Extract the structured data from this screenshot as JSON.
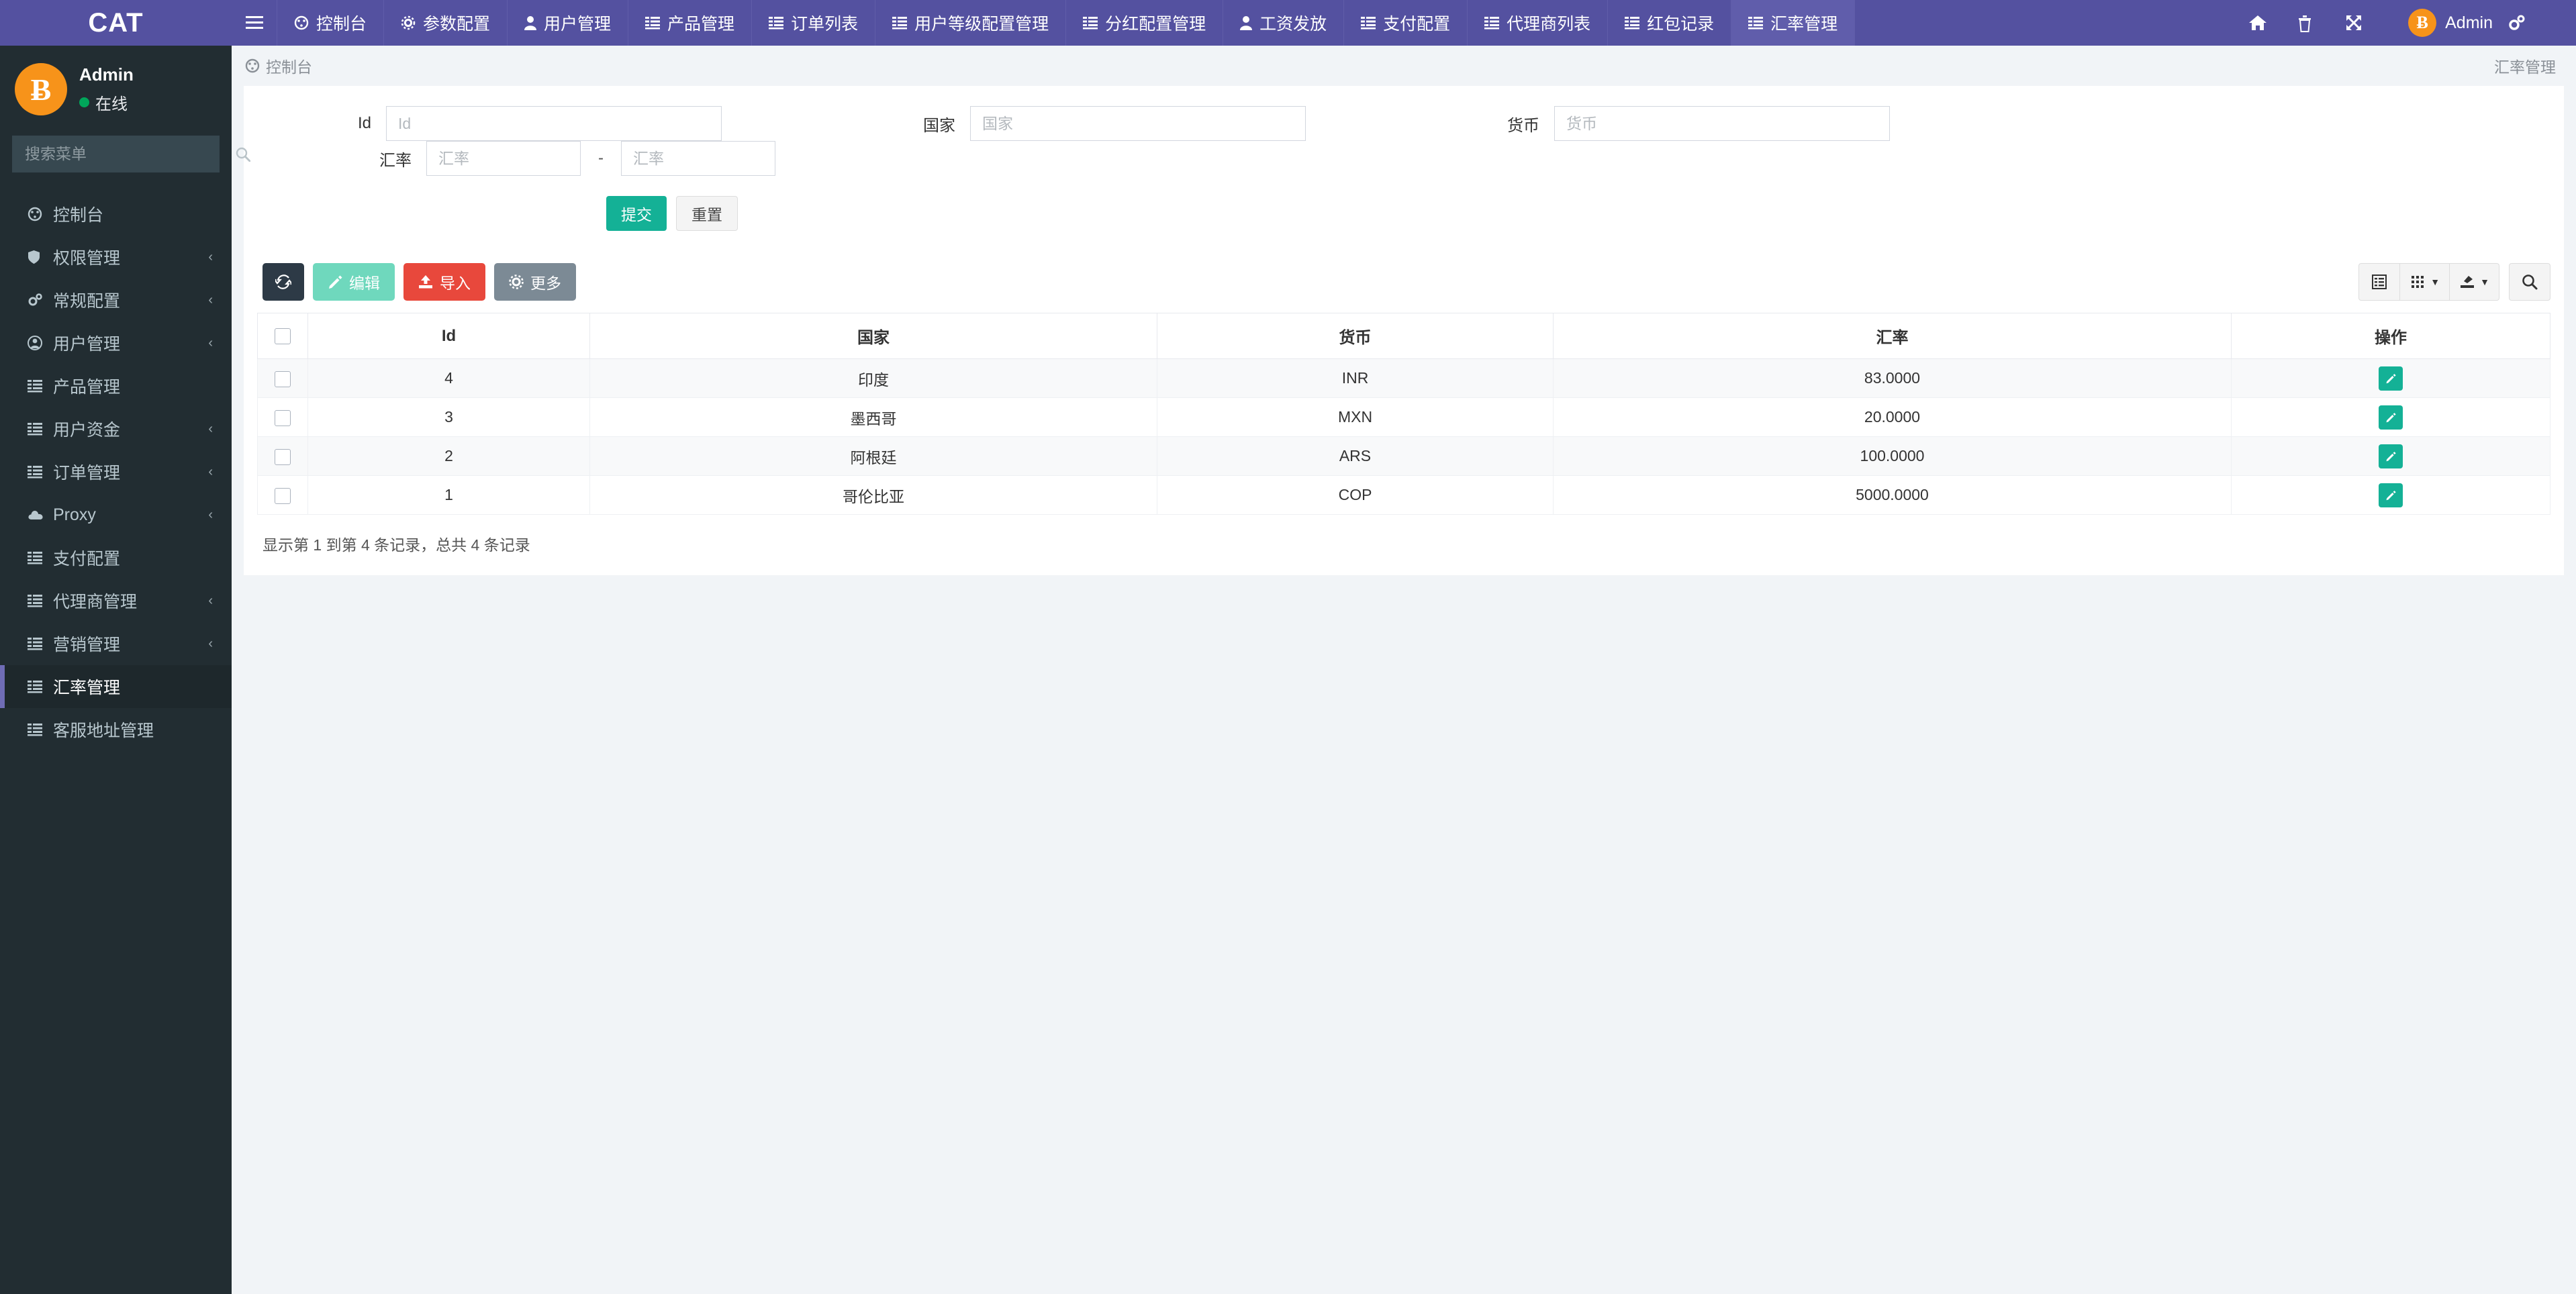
{
  "brand": {
    "title": "CAT"
  },
  "topnav": {
    "menu_icon": "hamburger-icon",
    "tabs": [
      {
        "label": "控制台",
        "icon": "dashboard-icon",
        "active": false
      },
      {
        "label": "参数配置",
        "icon": "gear-icon",
        "active": false
      },
      {
        "label": "用户管理",
        "icon": "user-icon",
        "active": false
      },
      {
        "label": "产品管理",
        "icon": "list-icon",
        "active": false
      },
      {
        "label": "订单列表",
        "icon": "list-icon",
        "active": false
      },
      {
        "label": "用户等级配置管理",
        "icon": "list-icon",
        "active": false
      },
      {
        "label": "分红配置管理",
        "icon": "list-icon",
        "active": false
      },
      {
        "label": "工资发放",
        "icon": "user-icon",
        "active": false
      },
      {
        "label": "支付配置",
        "icon": "list-icon",
        "active": false
      },
      {
        "label": "代理商列表",
        "icon": "list-icon",
        "active": false
      },
      {
        "label": "红包记录",
        "icon": "list-icon",
        "active": false
      },
      {
        "label": "汇率管理",
        "icon": "list-icon",
        "active": true
      }
    ],
    "right_icons": [
      {
        "name": "home-icon",
        "glyph": "⌂"
      },
      {
        "name": "trash-icon",
        "glyph": "🗑"
      },
      {
        "name": "fullscreen-icon",
        "glyph": "⤢"
      }
    ],
    "user": {
      "name": "Admin",
      "avatar": "bitcoin-icon",
      "avatar_glyph": "Ƀ"
    },
    "settings_icon": "gears-icon"
  },
  "sidebar": {
    "user": {
      "name": "Admin",
      "status": "在线",
      "avatar_glyph": "Ƀ"
    },
    "search": {
      "placeholder": "搜索菜单",
      "value": "",
      "icon": "search-icon"
    },
    "items": [
      {
        "label": "控制台",
        "icon": "dashboard-icon",
        "arrow": "",
        "active": false
      },
      {
        "label": "权限管理",
        "icon": "shield-icon",
        "arrow": "‹",
        "active": false
      },
      {
        "label": "常规配置",
        "icon": "gears-icon",
        "arrow": "‹",
        "active": false
      },
      {
        "label": "用户管理",
        "icon": "user-circle-icon",
        "arrow": "‹",
        "active": false
      },
      {
        "label": "产品管理",
        "icon": "list-icon",
        "arrow": "",
        "active": false
      },
      {
        "label": "用户资金",
        "icon": "list-icon",
        "arrow": "‹",
        "active": false
      },
      {
        "label": "订单管理",
        "icon": "list-icon",
        "arrow": "‹",
        "active": false
      },
      {
        "label": "Proxy",
        "icon": "cloud-icon",
        "arrow": "‹",
        "active": false
      },
      {
        "label": "支付配置",
        "icon": "list-icon",
        "arrow": "",
        "active": false
      },
      {
        "label": "代理商管理",
        "icon": "list-icon",
        "arrow": "‹",
        "active": false
      },
      {
        "label": "营销管理",
        "icon": "list-icon",
        "arrow": "‹",
        "active": false
      },
      {
        "label": "汇率管理",
        "icon": "list-icon",
        "arrow": "",
        "active": true
      },
      {
        "label": "客服地址管理",
        "icon": "list-icon",
        "arrow": "",
        "active": false
      }
    ]
  },
  "breadcrumb": {
    "icon": "dashboard-icon",
    "text": "控制台",
    "right_text": "汇率管理"
  },
  "filters": {
    "fields": [
      {
        "label": "Id",
        "placeholder": "Id",
        "value": ""
      },
      {
        "label": "国家",
        "placeholder": "国家",
        "value": ""
      },
      {
        "label": "货币",
        "placeholder": "货币",
        "value": ""
      }
    ],
    "range": {
      "label": "汇率",
      "from_placeholder": "汇率",
      "from_value": "",
      "separator": "-",
      "to_placeholder": "汇率",
      "to_value": ""
    },
    "submit_label": "提交",
    "reset_label": "重置"
  },
  "toolbar": {
    "refresh": {
      "label": "",
      "icon": "refresh-icon"
    },
    "edit": {
      "label": "编辑",
      "icon": "pencil-icon"
    },
    "import": {
      "label": "导入",
      "icon": "upload-icon"
    },
    "more": {
      "label": "更多",
      "icon": "gear-icon"
    },
    "right": [
      {
        "name": "list-view-icon",
        "caret": false
      },
      {
        "name": "columns-icon",
        "caret": true
      },
      {
        "name": "export-icon",
        "caret": true
      }
    ],
    "search": {
      "name": "search-icon"
    }
  },
  "table": {
    "columns": [
      "",
      "Id",
      "国家",
      "货币",
      "汇率",
      "操作"
    ],
    "rows": [
      {
        "id": "4",
        "country": "印度",
        "currency": "INR",
        "rate": "83.0000",
        "action_icon": "pencil-icon"
      },
      {
        "id": "3",
        "country": "墨西哥",
        "currency": "MXN",
        "rate": "20.0000",
        "action_icon": "pencil-icon"
      },
      {
        "id": "2",
        "country": "阿根廷",
        "currency": "ARS",
        "rate": "100.0000",
        "action_icon": "pencil-icon"
      },
      {
        "id": "1",
        "country": "哥伦比亚",
        "currency": "COP",
        "rate": "5000.0000",
        "action_icon": "pencil-icon"
      }
    ],
    "footer_text": "显示第 1 到第 4 条记录，总共 4 条记录"
  },
  "colors": {
    "brand_purple": "#5451a0",
    "active_purple": "#605dab",
    "sidebar_dark": "#222d32",
    "teal": "#14b196",
    "red": "#e8483c",
    "orange": "#f7931a",
    "gray": "#7c8a95"
  }
}
